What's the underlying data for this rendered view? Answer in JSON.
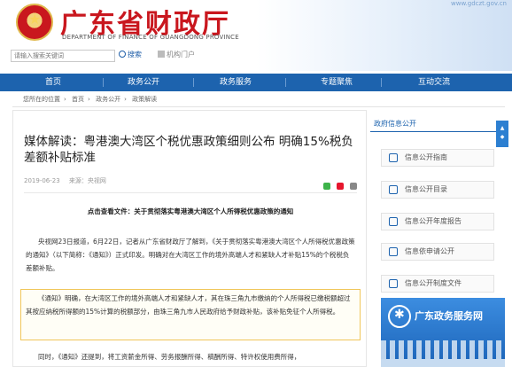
{
  "header": {
    "site_title": "广东省财政厅",
    "site_subtitle": "DEPARTMENT OF FINANCE OF GUANGDONG PROVINCE",
    "top_right": "www.gdczt.gov.cn"
  },
  "search": {
    "placeholder": "请输入搜索关键词",
    "button": "搜索",
    "portal": "机构门户"
  },
  "nav": [
    "首页",
    "政务公开",
    "政务服务",
    "专题聚焦",
    "互动交流"
  ],
  "breadcrumb": [
    "您所在的位置",
    "首页",
    "政务公开",
    "政策解读"
  ],
  "article": {
    "title": "媒体解读：粤港澳大湾区个税优惠政策细则公布 明确15%税负差额补贴标准",
    "date": "2019-06-23",
    "source": "来源：央视网",
    "click_line": "点击查看文件：关于贯彻落实粤港澳大湾区个人所得税优惠政策的通知",
    "para1": "央视网23日报道，6月22日，记者从广东省财政厅了解到，《关于贯彻落实粤港澳大湾区个人所得税优惠政策的通知》（以下简称：《通知》）正式印发。明确对在大湾区工作的境外高端人才和紧缺人才补贴15%的个税税负差额补贴。",
    "para2": "《通知》明确，在大湾区工作的境外高端人才和紧缺人才，其在珠三角九市缴纳的个人所得税已缴税额超过其按应纳税所得额的15%计算的税额部分，由珠三角九市人民政府给予财政补贴，该补贴免征个人所得税。",
    "para3": "同时，《通知》还提到，将工资薪金所得、劳务报酬所得、稿酬所得、特许权使用费所得，"
  },
  "sidebar": {
    "title": "政府信息公开",
    "items": [
      "信息公开指南",
      "信息公开目录",
      "信息公开年度报告",
      "信息依申请公开",
      "信息公开制度文件"
    ],
    "banner": "广东政务服务网"
  },
  "colors": {
    "brand_red": "#c9171e",
    "nav_blue": "#1d63ae",
    "highlight": "#f0c65a"
  }
}
